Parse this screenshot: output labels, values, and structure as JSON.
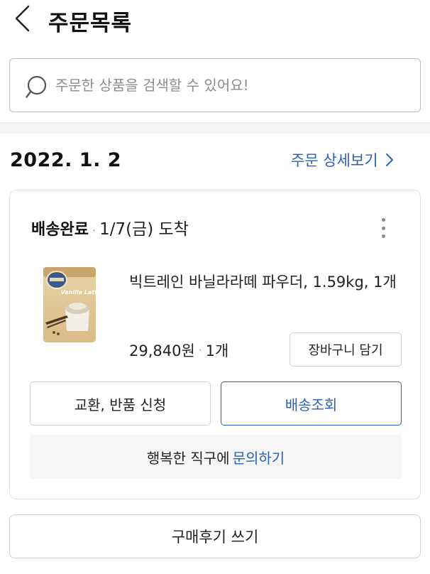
{
  "header": {
    "title": "주문목록",
    "back_icon": "chevron-left-icon"
  },
  "search": {
    "placeholder": "주문한 상품을 검색할 수 있어요!",
    "value": "",
    "icon": "search-icon"
  },
  "order": {
    "date": "2022. 1. 2",
    "detail_link": "주문 상세보기",
    "status": "배송완료",
    "arrival": "1/7(금) 도착",
    "more_icon": "more-vertical-icon",
    "product": {
      "name": "빅트레인 바닐라라떼 파우더, 1.59kg, 1개",
      "price": "29,840원",
      "quantity": "1개",
      "image_text": "Vanilla Latte"
    },
    "buttons": {
      "add_to_cart": "장바구니 담기",
      "exchange_return": "교환, 반품 신청",
      "track_delivery": "배송조회"
    },
    "inquiry": {
      "prefix": "행복한 직구에",
      "link": "문의하기"
    }
  },
  "review_button": "구매후기 쓰기",
  "colors": {
    "accent": "#2a62b5",
    "border": "#cfcfcf",
    "band": "#f4f4f4",
    "text": "#222222"
  }
}
